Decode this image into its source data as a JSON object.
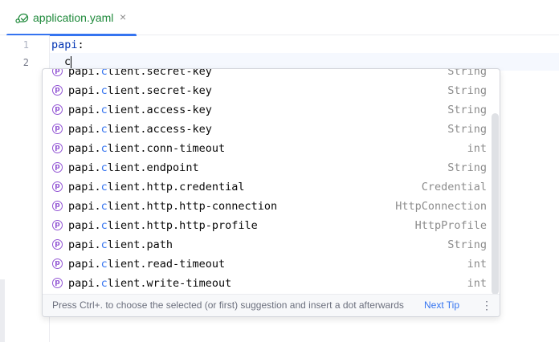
{
  "tab": {
    "file_name": "application.yaml",
    "close_glyph": "×",
    "icon": "yaml-file-icon"
  },
  "editor": {
    "line_numbers": [
      "1",
      "2"
    ],
    "line1_key": "papi",
    "line1_colon": ":",
    "line2_typed": "c"
  },
  "completion": {
    "item_icon": "property-icon",
    "item_icon_letter": "p",
    "highlight_color": "#3574f0",
    "items": [
      {
        "prefix": "papi.",
        "match": "c",
        "rest": "lient.secret-key",
        "type": "String"
      },
      {
        "prefix": "papi.",
        "match": "c",
        "rest": "lient.secret-key",
        "type": "String"
      },
      {
        "prefix": "papi.",
        "match": "c",
        "rest": "lient.access-key",
        "type": "String"
      },
      {
        "prefix": "papi.",
        "match": "c",
        "rest": "lient.access-key",
        "type": "String"
      },
      {
        "prefix": "papi.",
        "match": "c",
        "rest": "lient.conn-timeout",
        "type": "int"
      },
      {
        "prefix": "papi.",
        "match": "c",
        "rest": "lient.endpoint",
        "type": "String"
      },
      {
        "prefix": "papi.",
        "match": "c",
        "rest": "lient.http.credential",
        "type": "Credential"
      },
      {
        "prefix": "papi.",
        "match": "c",
        "rest": "lient.http.http-connection",
        "type": "HttpConnection"
      },
      {
        "prefix": "papi.",
        "match": "c",
        "rest": "lient.http.http-profile",
        "type": "HttpProfile"
      },
      {
        "prefix": "papi.",
        "match": "c",
        "rest": "lient.path",
        "type": "String"
      },
      {
        "prefix": "papi.",
        "match": "c",
        "rest": "lient.read-timeout",
        "type": "int"
      },
      {
        "prefix": "papi.",
        "match": "c",
        "rest": "lient.write-timeout",
        "type": "int"
      }
    ],
    "footer": {
      "hint": "Press Ctrl+. to choose the selected (or first) suggestion and insert a dot afterwards",
      "next_tip": "Next Tip",
      "more_glyph": "⋮"
    }
  }
}
